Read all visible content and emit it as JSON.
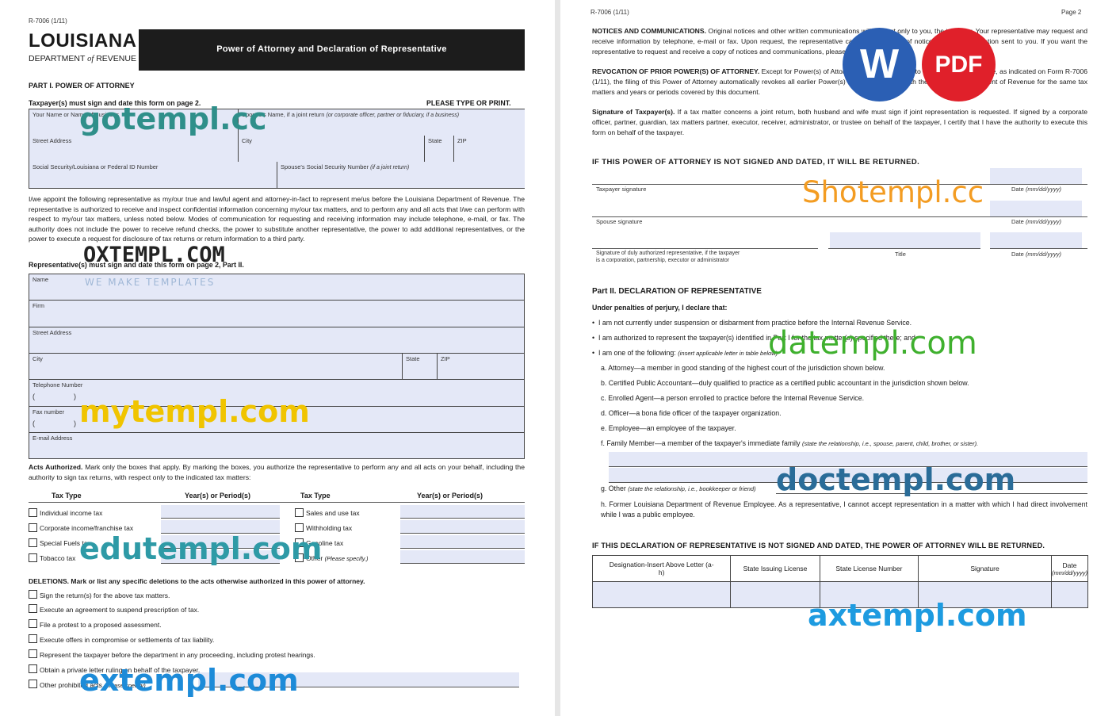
{
  "form_id": "R-7006 (1/11)",
  "page2_label": "Page 2",
  "logo": {
    "line1": "LOUISIANA",
    "line2a": "DEPARTMENT",
    "line2b": "of",
    "line2c": "REVENUE"
  },
  "form_title": "Power of Attorney and Declaration of Representative",
  "part1": {
    "heading": "PART I. POWER OF ATTORNEY",
    "taxpayer_note": "Taxpayer(s) must sign and date this form on page 2.",
    "type_note": "PLEASE TYPE OR PRINT.",
    "your_name": "Your Name or Name of Business",
    "spouse_name": "Spouse's Name, if a joint return",
    "spouse_name_hint": "(or corporate officer, partner or fiduciary, if a business)",
    "street_address": "Street Address",
    "city": "City",
    "state": "State",
    "zip": "ZIP",
    "ssn": "Social Security/Louisiana or Federal ID Number",
    "spouse_ssn": "Spouse's Social Security Number",
    "spouse_ssn_hint": "(if a joint return)",
    "appoint_text": "I/we appoint the following representative as my/our true and lawful agent and attorney-in-fact to represent me/us before the Louisiana Department of Revenue. The representative is authorized to receive and inspect confidential information concerning my/our tax matters, and to perform any and all acts that I/we can perform with respect to my/our tax matters, unless noted below. Modes of communication for requesting and receiving information may include telephone, e-mail, or fax. The authority does not include the power to receive refund checks, the power to substitute another representative, the power to add additional representatives, or the power to execute a request for disclosure of tax returns or return information to a third party.",
    "rep_note": "Representative(s) must sign and date this form on page 2, Part II.",
    "rep_fields": {
      "name": "Name",
      "firm": "Firm",
      "street": "Street Address",
      "city": "City",
      "state": "State",
      "zip": "ZIP",
      "telephone": "Telephone Number",
      "fax": "Fax number",
      "email": "E-mail Address",
      "paren_open": "(",
      "paren_close": ")"
    },
    "acts_text_bold": "Acts Authorized.",
    "acts_text": "Mark only the boxes that apply. By marking the boxes, you authorize the representative to perform any and all acts on your behalf, including the authority to sign tax returns, with respect only to the indicated tax matters:",
    "tax_type_header": "Tax Type",
    "years_header": "Year(s) or Period(s)",
    "tax_left": [
      "Individual income tax",
      "Corporate income/franchise tax",
      "Special Fuels tax",
      "Tobacco tax"
    ],
    "tax_right": [
      "Sales and use tax",
      "Withholding tax",
      "Gasoline tax",
      "Other"
    ],
    "other_hint": "(Please specify.)",
    "deletions_heading": "DELETIONS. Mark or list any specific deletions to the acts otherwise authorized in this power of attorney.",
    "deletions": [
      "Sign the return(s) for the above tax matters.",
      "Execute an agreement to suspend prescription of tax.",
      "File a protest to a proposed assessment.",
      "Execute offers in compromise or settlements of tax liability.",
      "Represent the taxpayer before the department in any proceeding, including protest hearings.",
      "Obtain a private letter ruling on behalf of the taxpayer.",
      "Other prohibited acts"
    ],
    "deletions_other_hint": "(please specify)"
  },
  "page2": {
    "notices_bold": "NOTICES AND COMMUNICATIONS.",
    "notices_text": "Original notices and other written communications will be sent only to you, the taxpayer. Your representative may request and receive information by telephone, e-mail or fax. Upon request, the representative can receive copies of notices and communication sent to you. If you want the representative to request and receive a copy of notices and communications, please specify.",
    "revocation_bold": "REVOCATION OF PRIOR POWER(S) OF ATTORNEY.",
    "revocation_text": "Except for Power(s) of Attorney previously granted to the same representative, as indicated on Form R-7006 (1/11), the filing of this Power of Attorney automatically revokes all earlier Power(s) of Attorney on file with the Louisiana Department of Revenue for the same tax matters and years or periods covered by this document.",
    "signature_bold": "Signature of Taxpayer(s).",
    "signature_text": "If a tax matter concerns a joint return, both husband and wife must sign if joint representation is requested. If signed by a corporate officer, partner, guardian, tax matters partner, executor, receiver, administrator, or trustee on behalf of the taxpayer, I certify that I have the authority to execute this form on behalf of the taxpayer.",
    "not_signed_warning": "IF THIS POWER OF ATTORNEY IS NOT SIGNED AND DATED, IT WILL BE RETURNED.",
    "taxpayer_signature": "Taxpayer signature",
    "spouse_signature": "Spouse signature",
    "authorized_rep_signature_1": "Signature of duly authorized representative, if the taxpayer",
    "authorized_rep_signature_2": "is a corporation, partnership, executor or administrator",
    "title_label": "Title",
    "date_label": "Date",
    "date_hint": "(mm/dd/yyyy)",
    "part2_heading": "Part II. DECLARATION OF REPRESENTATIVE",
    "perjury": "Under penalties of perjury, I declare that:",
    "bullets": [
      "I am not currently under suspension or disbarment from practice before the Internal Revenue Service.",
      "I am authorized to represent the taxpayer(s) identified in Part I for the tax matter(s) specified there; and",
      "I am one of the following:"
    ],
    "bullet3_hint": "(insert applicable letter in table below)",
    "letters": [
      "a. Attorney—a member in good standing of the highest court of the jurisdiction shown below.",
      "b. Certified Public Accountant—duly qualified to practice as a certified public accountant in the jurisdiction shown below.",
      "c. Enrolled Agent—a person enrolled to practice before the Internal Revenue Service.",
      "d. Officer—a bona fide officer of the taxpayer organization.",
      "e. Employee—an employee of the taxpayer."
    ],
    "letter_f": "f. Family Member—a member of the taxpayer's immediate family",
    "letter_f_hint": "(state the relationship, i.e., spouse, parent, child, brother, or sister).",
    "letter_g": "g. Other",
    "letter_g_hint": "(state the relationship, i.e., bookkeeper or friend)",
    "letter_h": "h. Former Louisiana Department of Revenue Employee. As a representative, I cannot accept representation in a matter with which I had direct involvement while I was a public employee.",
    "decl_warning": "IF THIS DECLARATION OF REPRESENTATIVE IS NOT SIGNED AND DATED, THE POWER OF ATTORNEY WILL BE RETURNED.",
    "table_headers": [
      "Designation-Insert Above Letter (a-h)",
      "State Issuing License",
      "State License Number",
      "Signature",
      "Date"
    ],
    "table_date_hint": "(mm/dd/yyyy)"
  },
  "watermarks": {
    "gotempl": "gotempl.cc",
    "oxtempl": "OXTEMPL.COM",
    "oxtempl_sub": "WE MAKE TEMPLATES",
    "mytempl": "mytempl.com",
    "edutempl": "edutempl.com",
    "extempl": "extempl.com",
    "shotempl": "Shotempl.cc",
    "datempl": "datempl.com",
    "doctempl": "doctempl.com",
    "axtempl": "axtempl.com",
    "badge_w": "W",
    "badge_pdf": "PDF"
  },
  "colors": {
    "title_bar": "#1c1c1c",
    "field_fill": "#e4e8f7",
    "word_blue": "#2b5fb4",
    "pdf_red": "#e0202a"
  }
}
